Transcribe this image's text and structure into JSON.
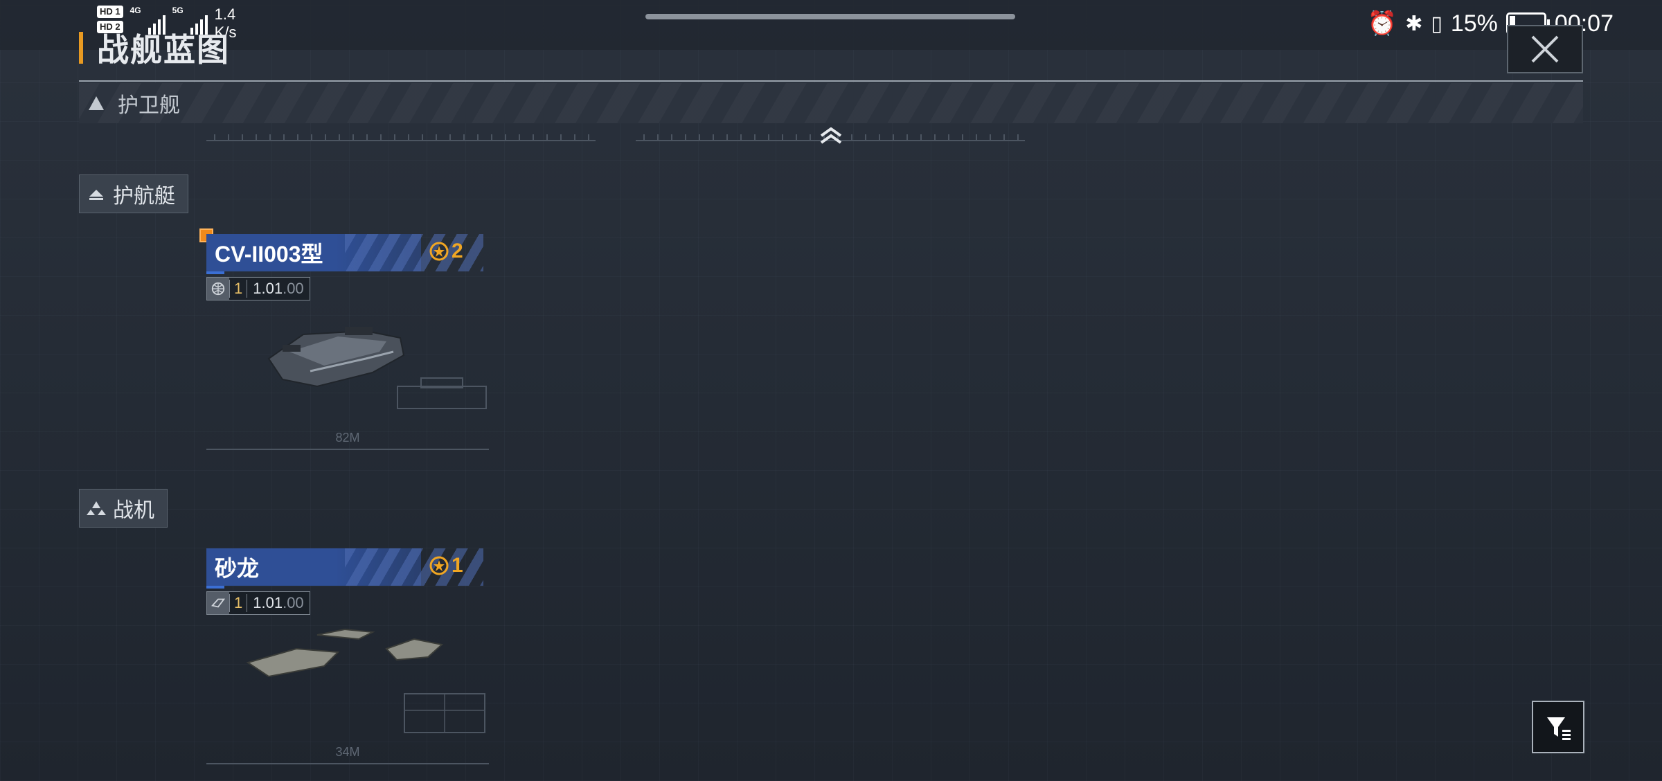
{
  "status_bar": {
    "sim1": "HD 1",
    "sim2": "HD 2",
    "net1": "4G",
    "net2": "5G",
    "speed_value": "1.4",
    "speed_unit": "K/s",
    "battery": "15%",
    "time": "00:07"
  },
  "header": {
    "title": "战舰蓝图"
  },
  "categories": {
    "frigate": "护卫舰",
    "corvette": "护航艇",
    "fighter": "战机"
  },
  "ships": [
    {
      "name": "CV-II003型",
      "stars": "2",
      "level": "1",
      "version_main": "1.01",
      "version_sub": ".00",
      "size": "82M",
      "icon": "globe-icon"
    },
    {
      "name": "砂龙",
      "stars": "1",
      "level": "1",
      "version_main": "1.01",
      "version_sub": ".00",
      "size": "34M",
      "icon": "brand-icon"
    }
  ],
  "colors": {
    "accent_orange": "#e89a22",
    "title_blue": "#2f4f96",
    "star_gold": "#f0a623"
  }
}
